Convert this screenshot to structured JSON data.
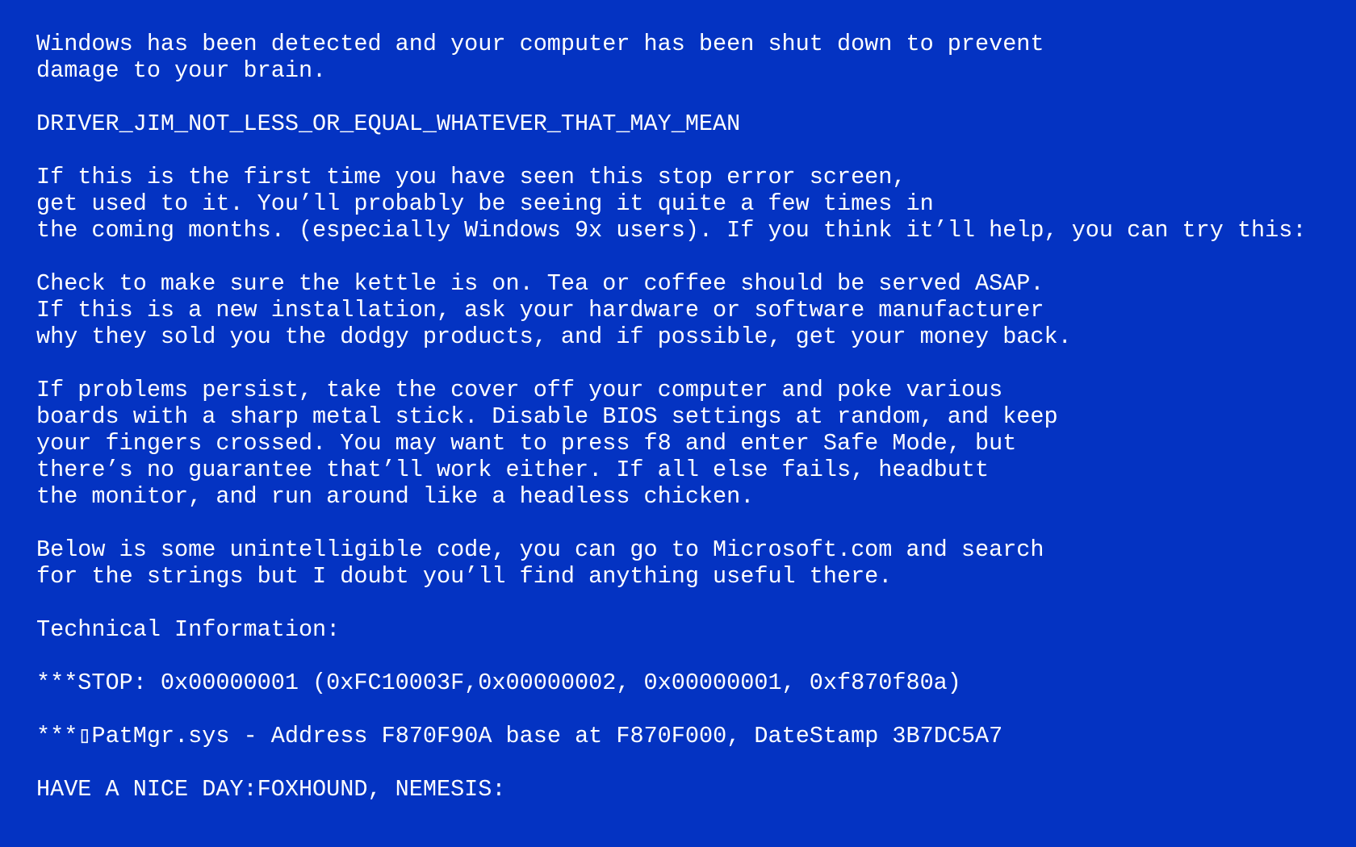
{
  "screen": {
    "background_color": "#0433C2",
    "text_color": "#FFFFFF"
  },
  "intro": {
    "line1": "Windows has been detected and your computer has been shut down to prevent",
    "line2": "damage to your brain."
  },
  "error_code": "DRIVER_JIM_NOT_LESS_OR_EQUAL_WHATEVER_THAT_MAY_MEAN",
  "first_time": {
    "line1": "If this is the first time you have seen this stop error screen,",
    "line2": "get used to it. You’ll probably be seeing it quite a few times in",
    "line3": "the coming months. (especially Windows 9x users). If you think it’ll help, you can try this:"
  },
  "checks": {
    "line1": "Check to make sure the kettle is on. Tea or coffee should be served ASAP.",
    "line2": "If this is a new installation, ask your hardware or software manufacturer",
    "line3": "why they sold you the dodgy products, and if possible, get your money back."
  },
  "problems": {
    "line1": "If problems persist, take the cover off your computer and poke various",
    "line2": "boards with a sharp metal stick. Disable BIOS settings at random, and keep",
    "line3": "your fingers crossed. You may want to press f8 and enter Safe Mode, but",
    "line4": "there’s no guarantee that’ll work either. If all else fails, headbutt",
    "line5": "the monitor, and run around like a headless chicken."
  },
  "below": {
    "line1": "Below is some unintelligible code, you can go to Microsoft.com and search",
    "line2": "for the strings but I doubt you’ll find anything useful there."
  },
  "technical": {
    "heading": "Technical Information:",
    "stop_line": "***STOP: 0x00000001 (0xFC10003F,0x00000002, 0x00000001, 0xf870f80a)",
    "driver_line": "***▯PatMgr.sys - Address F870F90A base at F870F000, DateStamp 3B7DC5A7"
  },
  "signoff": "HAVE A NICE DAY:FOXHOUND, NEMESIS:"
}
